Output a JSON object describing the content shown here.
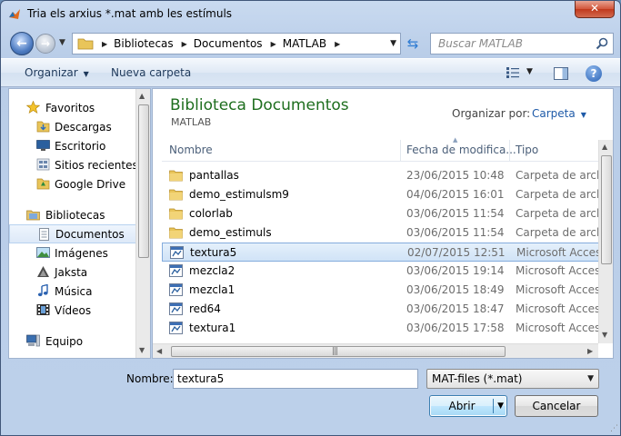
{
  "window": {
    "title": "Tria els arxius *.mat amb les estímuls"
  },
  "address_bar": {
    "crumbs": [
      "Bibliotecas",
      "Documentos",
      "MATLAB"
    ],
    "search_placeholder": "Buscar MATLAB"
  },
  "toolbar": {
    "organize_label": "Organizar",
    "new_folder_label": "Nueva carpeta"
  },
  "nav": {
    "favorites": {
      "label": "Favoritos",
      "items": [
        "Descargas",
        "Escritorio",
        "Sitios recientes",
        "Google Drive"
      ]
    },
    "libraries": {
      "label": "Bibliotecas",
      "items": [
        "Documentos",
        "Imágenes",
        "Jaksta",
        "Música",
        "Vídeos"
      ],
      "selected": "Documentos"
    },
    "computer": {
      "label": "Equipo"
    }
  },
  "content": {
    "library_title": "Biblioteca Documentos",
    "library_subtitle": "MATLAB",
    "arrange_label": "Organizar por:",
    "arrange_value": "Carpeta",
    "columns": {
      "name": "Nombre",
      "date": "Fecha de modifica...",
      "type": "Tipo"
    },
    "files": [
      {
        "name": "pantallas",
        "date": "23/06/2015 10:48",
        "type": "Carpeta de archivos",
        "kind": "folder"
      },
      {
        "name": "demo_estimulsm9",
        "date": "04/06/2015 16:01",
        "type": "Carpeta de archivos",
        "kind": "folder"
      },
      {
        "name": "colorlab",
        "date": "03/06/2015 11:54",
        "type": "Carpeta de archivos",
        "kind": "folder"
      },
      {
        "name": "demo_estimuls",
        "date": "03/06/2015 11:54",
        "type": "Carpeta de archivos",
        "kind": "folder"
      },
      {
        "name": "textura5",
        "date": "02/07/2015 12:51",
        "type": "Microsoft Access",
        "kind": "mat",
        "selected": true
      },
      {
        "name": "mezcla2",
        "date": "03/06/2015 19:14",
        "type": "Microsoft Access",
        "kind": "mat"
      },
      {
        "name": "mezcla1",
        "date": "03/06/2015 18:49",
        "type": "Microsoft Access",
        "kind": "mat"
      },
      {
        "name": "red64",
        "date": "03/06/2015 18:47",
        "type": "Microsoft Access",
        "kind": "mat"
      },
      {
        "name": "textura1",
        "date": "03/06/2015 17:58",
        "type": "Microsoft Access",
        "kind": "mat"
      }
    ]
  },
  "footer": {
    "name_label": "Nombre:",
    "name_value": "textura5",
    "filetype_value": "MAT-files (*.mat)",
    "open_label": "Abrir",
    "cancel_label": "Cancelar"
  },
  "colors": {
    "library_title": "#1e6e1e",
    "link_blue": "#1e5aa8",
    "selection_border": "#84acdd",
    "close_red": "#c0391c"
  }
}
